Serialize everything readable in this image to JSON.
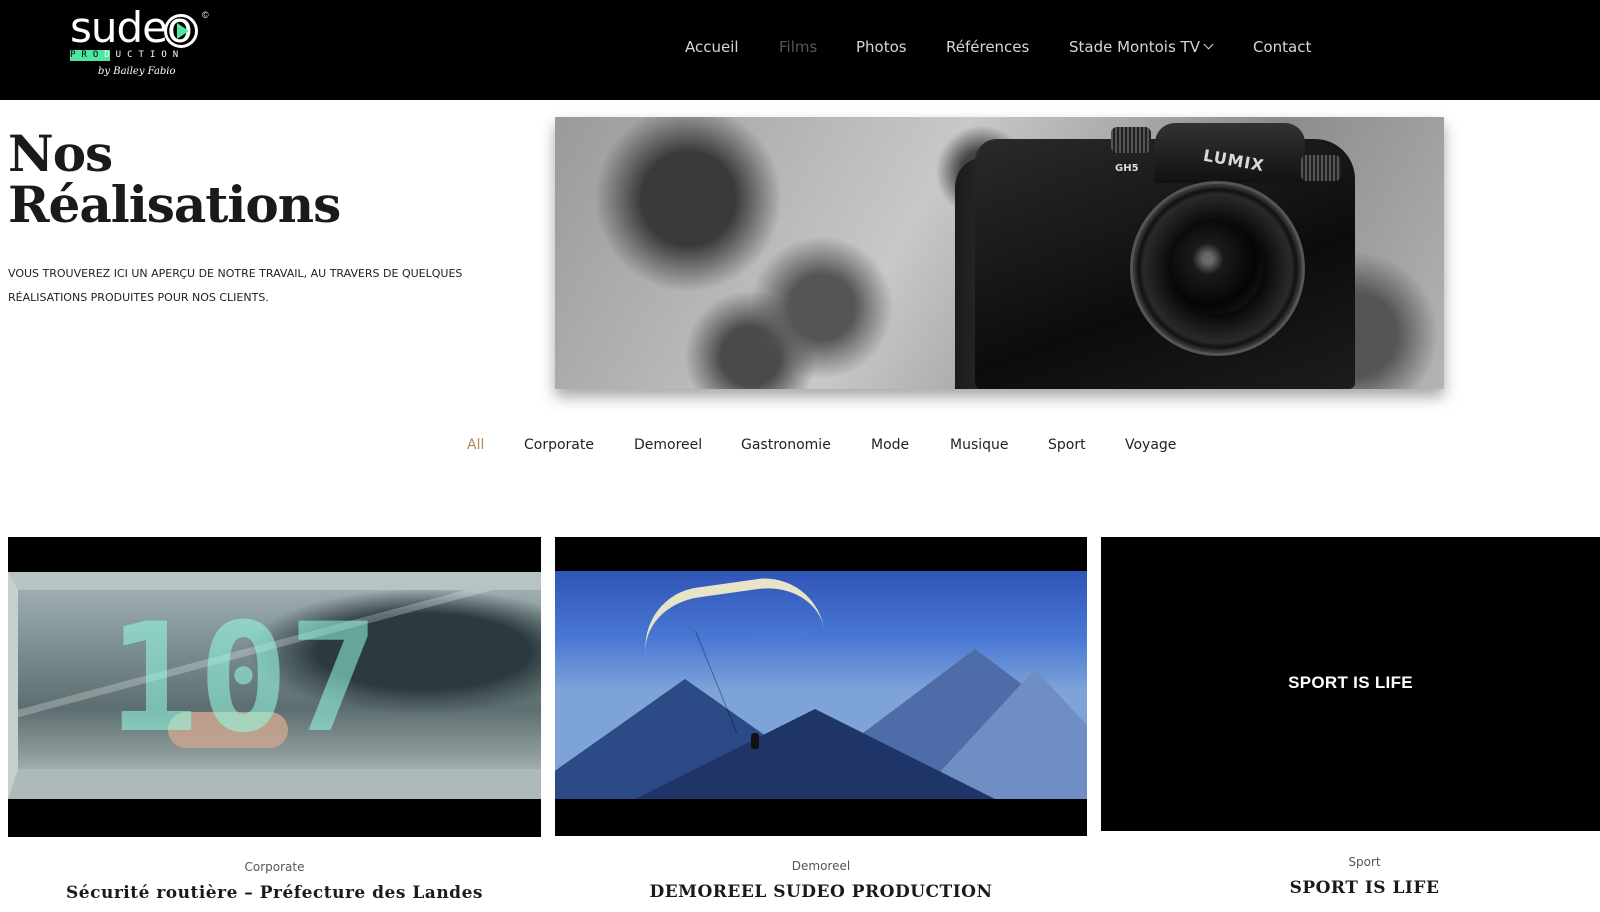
{
  "brand": {
    "logo_word": "sudeo",
    "logo_copyright": "©",
    "logo_sub_pro": "PRO",
    "logo_sub_rest": "DUCTION",
    "logo_by": "by Bailey Fabio",
    "accent_color": "#4ee6a0"
  },
  "nav": {
    "items": [
      {
        "label": "Accueil"
      },
      {
        "label": "Films"
      },
      {
        "label": "Photos"
      },
      {
        "label": "Références"
      },
      {
        "label": "Stade Montois TV"
      },
      {
        "label": "Contact"
      }
    ],
    "active": "Films"
  },
  "hero": {
    "title_line1": "Nos",
    "title_line2": "Réalisations",
    "intro": "Vous trouverez ici un aperçu de notre travail, au travers de quelques réalisations produites pour nos clients.",
    "image_icon": "camera-lumix-image",
    "camera_brand": "LUMIX",
    "camera_model": "GH5"
  },
  "filters": {
    "items": [
      "All",
      "Corporate",
      "Demoreel",
      "Gastronomie",
      "Mode",
      "Musique",
      "Sport",
      "Voyage"
    ],
    "active": "All",
    "active_color": "#b08a5a"
  },
  "cards": [
    {
      "category": "Corporate",
      "title": "Sécurité routière – Préfecture des Landes",
      "thumb": "car-driver-thumbnail",
      "overlay_digits": "107"
    },
    {
      "category": "Demoreel",
      "title": "DEMOREEL SUDEO PRODUCTION",
      "thumb": "paraglider-mountains-thumbnail"
    },
    {
      "category": "Sport",
      "title": "SPORT IS LIFE",
      "thumb_text": "SPORT IS LIFE"
    }
  ]
}
